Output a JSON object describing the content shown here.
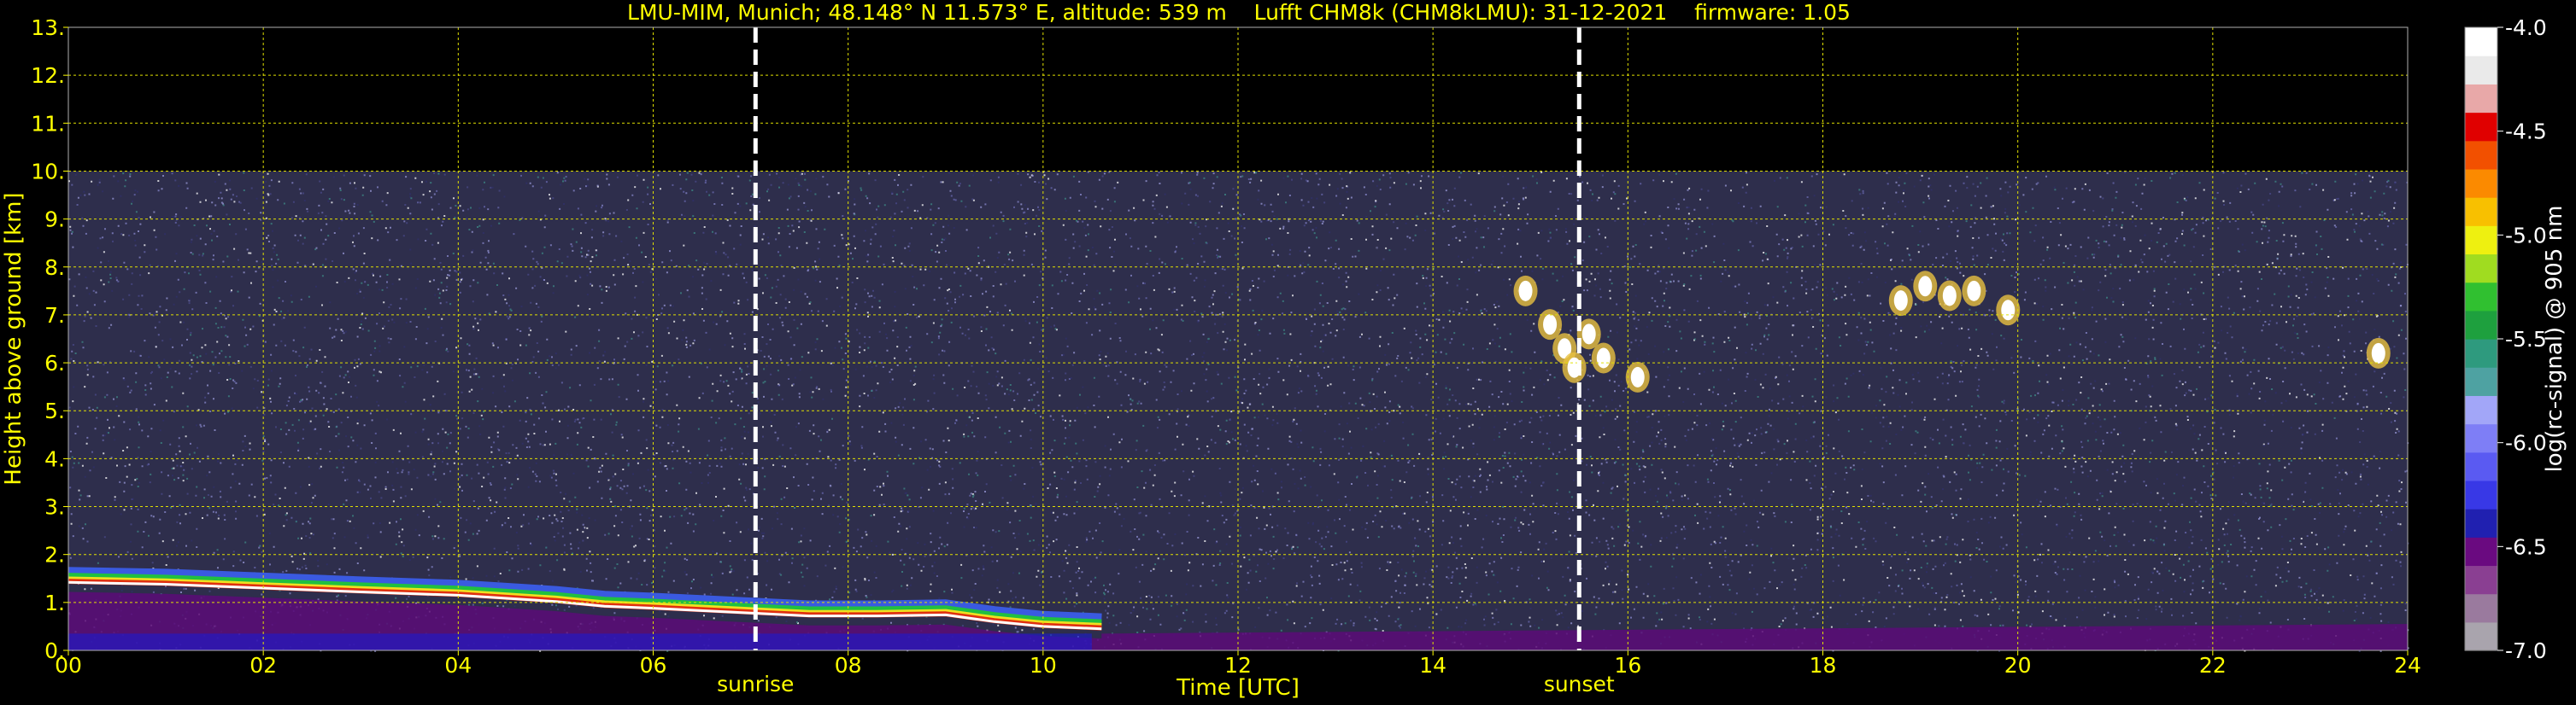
{
  "chart_data": {
    "type": "heatmap",
    "title": "LMU-MIM, Munich; 48.148° N 11.573° E, altitude: 539 m    Lufft CHM8k (CHM8kLMU): 31-12-2021    firmware: 1.05",
    "xlabel": "Time [UTC]",
    "ylabel": "Height above ground [km]",
    "xlim": [
      0,
      24
    ],
    "ylim": [
      0,
      13
    ],
    "x_tick_values": [
      0,
      2,
      4,
      6,
      8,
      10,
      12,
      14,
      16,
      18,
      20,
      22,
      24
    ],
    "x_tick_labels": [
      "00",
      "02",
      "04",
      "06",
      "08",
      "10",
      "12",
      "14",
      "16",
      "18",
      "20",
      "22",
      "24"
    ],
    "y_tick_values": [
      0,
      1,
      2,
      3,
      4,
      5,
      6,
      7,
      8,
      9,
      10,
      11,
      12,
      13
    ],
    "y_tick_labels": [
      "0.",
      "1.",
      "2.",
      "3.",
      "4.",
      "5.",
      "6.",
      "7.",
      "8.",
      "9.",
      "10.",
      "11.",
      "12.",
      "13."
    ],
    "grid": true,
    "data_top_km": 10,
    "events": [
      {
        "label": "sunrise",
        "time": 7.05
      },
      {
        "label": "sunset",
        "time": 15.5
      }
    ],
    "boundary_layer": [
      [
        0.0,
        1.42
      ],
      [
        1.0,
        1.38
      ],
      [
        2.0,
        1.3
      ],
      [
        3.0,
        1.22
      ],
      [
        4.0,
        1.15
      ],
      [
        5.0,
        1.02
      ],
      [
        5.5,
        0.92
      ],
      [
        6.0,
        0.88
      ],
      [
        7.0,
        0.78
      ],
      [
        7.6,
        0.72
      ],
      [
        8.3,
        0.72
      ],
      [
        9.0,
        0.74
      ],
      [
        9.5,
        0.6
      ],
      [
        10.0,
        0.5
      ],
      [
        10.6,
        0.45
      ]
    ],
    "clouds": [
      {
        "t": 14.95,
        "h": 7.5
      },
      {
        "t": 15.2,
        "h": 6.8
      },
      {
        "t": 15.35,
        "h": 6.3
      },
      {
        "t": 15.45,
        "h": 5.9
      },
      {
        "t": 15.6,
        "h": 6.6
      },
      {
        "t": 15.75,
        "h": 6.1
      },
      {
        "t": 16.1,
        "h": 5.7
      },
      {
        "t": 18.8,
        "h": 7.3
      },
      {
        "t": 19.05,
        "h": 7.6
      },
      {
        "t": 19.3,
        "h": 7.4
      },
      {
        "t": 19.55,
        "h": 7.5
      },
      {
        "t": 19.9,
        "h": 7.1
      },
      {
        "t": 23.7,
        "h": 6.2
      }
    ],
    "colorbar": {
      "label": "log(rc-signal) @ 905 nm",
      "min": -7.0,
      "max": -4.0,
      "tick_values": [
        -4.0,
        -4.5,
        -5.0,
        -5.5,
        -6.0,
        -6.5,
        -7.0
      ],
      "tick_labels": [
        "-4.0",
        "-4.5",
        "-5.0",
        "-5.5",
        "-6.0",
        "-6.5",
        "-7.0"
      ],
      "colors": [
        "#a9a4ad",
        "#9a7a9e",
        "#8a3f92",
        "#6a0a80",
        "#2020b0",
        "#3838e6",
        "#5a5af2",
        "#7e7ef6",
        "#a2a6f8",
        "#4ea2a2",
        "#2e9a7e",
        "#1ea03e",
        "#30c030",
        "#a0dc20",
        "#eef010",
        "#f8c000",
        "#fb8a00",
        "#f25000",
        "#e00000",
        "#e8a8a8",
        "#eaeaea",
        "#ffffff"
      ]
    }
  }
}
